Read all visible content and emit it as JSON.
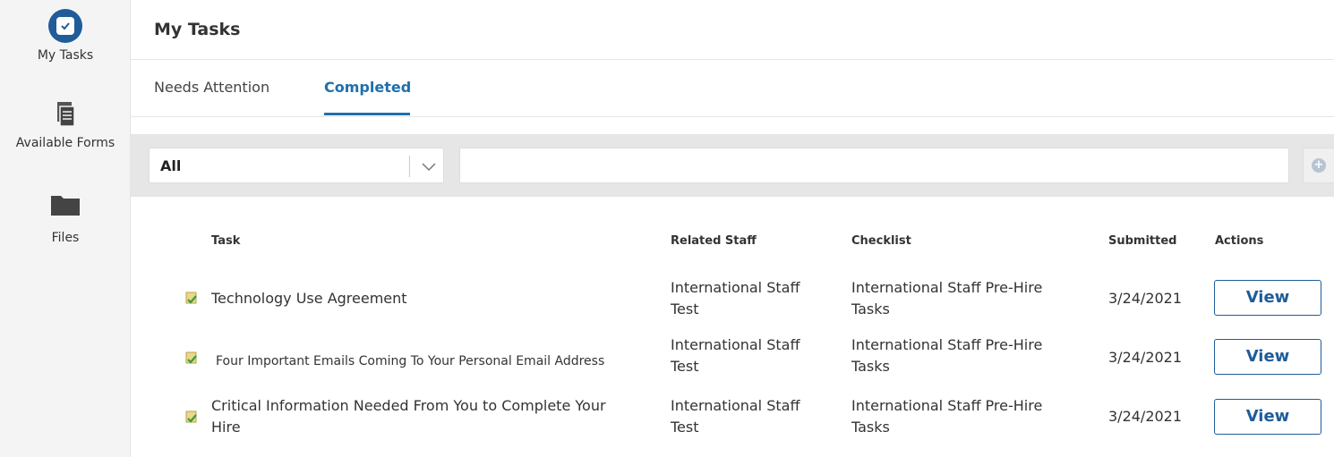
{
  "sidebar": {
    "items": [
      {
        "label": "My Tasks",
        "icon": "checkbox-icon",
        "active": true
      },
      {
        "label": "Available Forms",
        "icon": "document-icon",
        "active": false
      },
      {
        "label": "Files",
        "icon": "folder-icon",
        "active": false
      }
    ]
  },
  "header": {
    "title": "My Tasks"
  },
  "tabs": [
    {
      "label": "Needs Attention",
      "active": false
    },
    {
      "label": "Completed",
      "active": true
    }
  ],
  "filter": {
    "selected": "All",
    "search_value": "",
    "add_icon": "plus-circle-icon"
  },
  "table": {
    "columns": [
      "Task",
      "Related Staff",
      "Checklist",
      "Submitted",
      "Actions"
    ],
    "rows": [
      {
        "task_line1": "Technology Use Agreement",
        "task_line2": "",
        "staff_line1": "International Staff",
        "staff_line2": "Test",
        "checklist_line1": "International Staff Pre-Hire",
        "checklist_line2": "Tasks",
        "submitted": "3/24/2021",
        "action": "View"
      },
      {
        "task_line1": "Four Important Emails Coming To Your Personal Email Address",
        "task_line2": "",
        "staff_line1": "International Staff",
        "staff_line2": "Test",
        "checklist_line1": "International Staff Pre-Hire",
        "checklist_line2": "Tasks",
        "submitted": "3/24/2021",
        "action": "View"
      },
      {
        "task_line1": "Critical Information Needed From You to Complete Your",
        "task_line2": "Hire",
        "staff_line1": "International Staff",
        "staff_line2": "Test",
        "checklist_line1": "International Staff Pre-Hire",
        "checklist_line2": "Tasks",
        "submitted": "3/24/2021",
        "action": "View"
      }
    ]
  },
  "colors": {
    "accent": "#1f6fad",
    "brand": "#1f5c99",
    "filter_bg": "#e6e6e6"
  }
}
